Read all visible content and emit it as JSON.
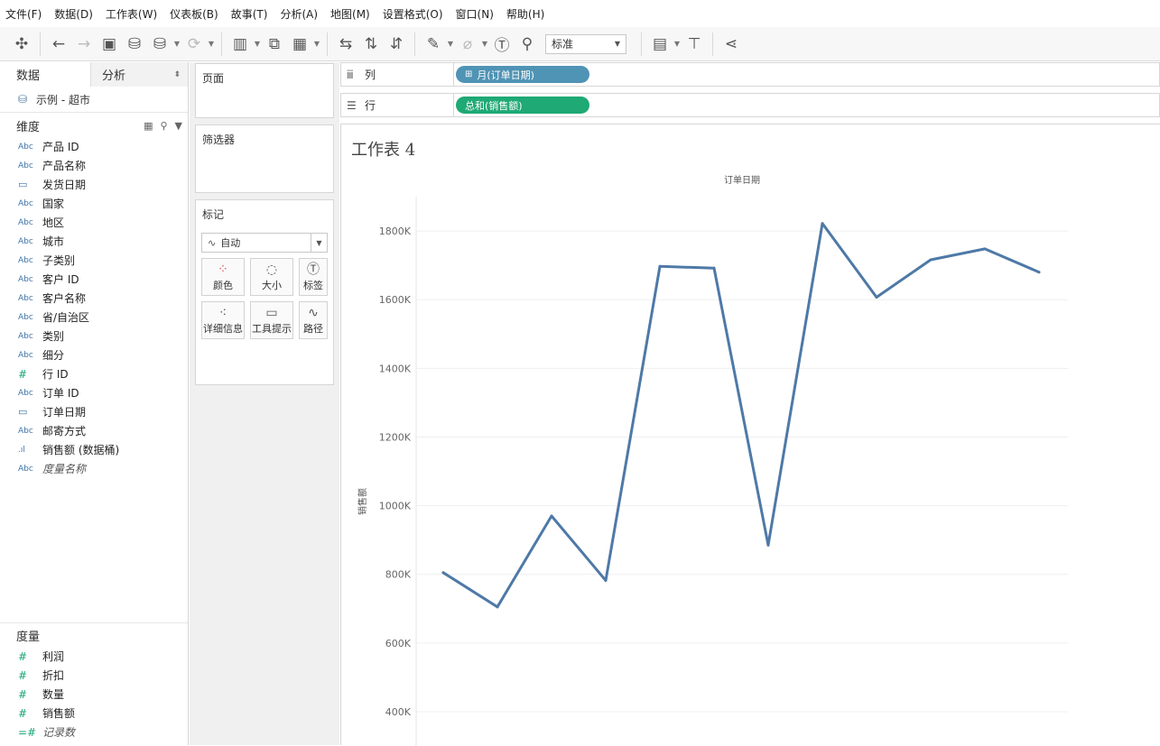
{
  "menu": [
    "文件(F)",
    "数据(D)",
    "工作表(W)",
    "仪表板(B)",
    "故事(T)",
    "分析(A)",
    "地图(M)",
    "设置格式(O)",
    "窗口(N)",
    "帮助(H)"
  ],
  "toolbar": {
    "fit_select": "标准"
  },
  "data_pane": {
    "tab_data": "数据",
    "tab_analysis": "分析",
    "datasource": "示例 - 超市",
    "dimensions_header": "维度",
    "dimensions": [
      {
        "icon": "Abc",
        "name": "产品 ID"
      },
      {
        "icon": "Abc",
        "name": "产品名称"
      },
      {
        "icon": "date",
        "name": "发货日期"
      },
      {
        "icon": "Abc",
        "name": "国家"
      },
      {
        "icon": "Abc",
        "name": "地区"
      },
      {
        "icon": "Abc",
        "name": "城市"
      },
      {
        "icon": "Abc",
        "name": "子类别"
      },
      {
        "icon": "Abc",
        "name": "客户 ID"
      },
      {
        "icon": "Abc",
        "name": "客户名称"
      },
      {
        "icon": "Abc",
        "name": "省/自治区"
      },
      {
        "icon": "Abc",
        "name": "类别"
      },
      {
        "icon": "Abc",
        "name": "细分"
      },
      {
        "icon": "#",
        "name": "行 ID"
      },
      {
        "icon": "Abc",
        "name": "订单 ID"
      },
      {
        "icon": "date",
        "name": "订单日期"
      },
      {
        "icon": "Abc",
        "name": "邮寄方式"
      },
      {
        "icon": "bin",
        "name": "销售额 (数据桶)"
      },
      {
        "icon": "Abc",
        "name": "度量名称"
      }
    ],
    "measures_header": "度量",
    "measures": [
      {
        "icon": "#",
        "name": "利润"
      },
      {
        "icon": "#",
        "name": "折扣"
      },
      {
        "icon": "#",
        "name": "数量"
      },
      {
        "icon": "#",
        "name": "销售额"
      },
      {
        "icon": "=#",
        "name": "记录数"
      }
    ]
  },
  "cards": {
    "pages": "页面",
    "filters": "筛选器",
    "marks": "标记",
    "marks_type": "自动",
    "mark_buttons": [
      "颜色",
      "大小",
      "标签",
      "详细信息",
      "工具提示",
      "路径"
    ]
  },
  "shelves": {
    "columns_label": "列",
    "columns_pill": "月(订单日期)",
    "rows_label": "行",
    "rows_pill": "总和(销售额)"
  },
  "sheet_title": "工作表 4",
  "chart_data": {
    "type": "line",
    "xlabel": "订单日期",
    "ylabel": "销售额",
    "ylim": [
      300,
      1900
    ],
    "yticks": [
      400,
      600,
      800,
      1000,
      1200,
      1400,
      1600,
      1800
    ],
    "ytick_suffix": "K",
    "color": "#4e79a7",
    "grid": true,
    "values": [
      805,
      705,
      970,
      782,
      1697,
      1692,
      885,
      1822,
      1607,
      1716,
      1748,
      1680
    ]
  },
  "colors": {
    "columns_pill": "#4f93b5",
    "rows_pill": "#1fa974",
    "line": "#4e79a7"
  }
}
